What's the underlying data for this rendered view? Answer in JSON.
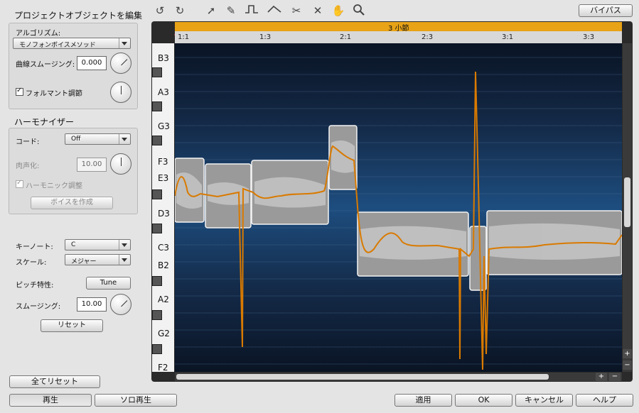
{
  "left_panel": {
    "project_edit_title": "プロジェクトオブジェクトを編集",
    "algorithm_label": "アルゴリズム:",
    "algorithm_value": "モノフォンボイスメソッド",
    "curve_smoothing_label": "曲線スムージング:",
    "curve_smoothing_value": "0.000",
    "formant_label": "フォルマント調節",
    "harmonizer_title": "ハーモナイザー",
    "chord_label": "コード:",
    "chord_value": "Off",
    "humanize_label": "肉声化:",
    "humanize_value": "10.00",
    "harmonic_adjust_label": "ハーモニック調整",
    "create_voice_button": "ボイスを作成",
    "key_note_label": "キーノート:",
    "key_note_value": "C",
    "scale_label": "スケール:",
    "scale_value": "メジャー",
    "pitch_char_label": "ピッチ特性:",
    "tune_button": "Tune",
    "smoothing_label": "スムージング:",
    "smoothing_value": "10.00",
    "reset_button": "リセット",
    "reset_all_button": "全てリセット"
  },
  "toolbar": {
    "bypass_button": "バイパス",
    "tools": [
      "undo-icon",
      "redo-icon",
      "pointer-icon",
      "pencil-icon",
      "step-line-icon",
      "curve-icon",
      "scissors-icon",
      "erase-icon",
      "hand-icon",
      "zoom-icon"
    ]
  },
  "editor": {
    "measure_bar_label": "3 小節",
    "ruler_ticks": [
      "1:1",
      "1:3",
      "2:1",
      "2:3",
      "3:1",
      "3:3"
    ],
    "note_labels": [
      "B3",
      "A3",
      "G3",
      "F3",
      "E3",
      "D3",
      "C3",
      "B2",
      "A2",
      "G2",
      "F2"
    ],
    "zoom_plus": "+",
    "zoom_minus": "−"
  },
  "bottom_bar": {
    "play_button": "再生",
    "solo_play_button": "ソロ再生",
    "apply_button": "適用",
    "ok_button": "OK",
    "cancel_button": "キャンセル",
    "help_button": "ヘルプ"
  },
  "colors": {
    "accent_orange": "#e8a317",
    "pitch_curve": "#d97a00",
    "grid_background_top": "#0a1424",
    "grid_background_mid": "#1d4d7f"
  }
}
